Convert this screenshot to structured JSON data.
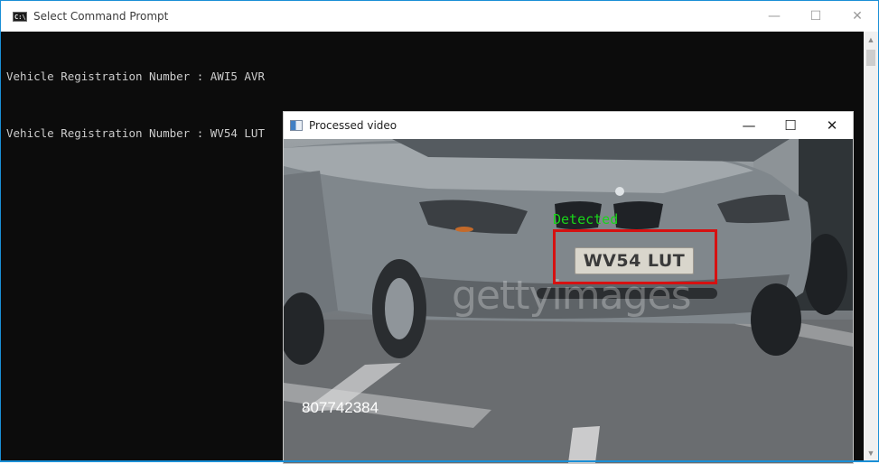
{
  "cmd": {
    "title": "Select Command Prompt",
    "icon": "console-icon",
    "lines": [
      "Vehicle Registration Number : AWI5 AVR",
      "Vehicle Registration Number : WV54 LUT"
    ],
    "controls": {
      "minimize": "—",
      "maximize": "☐",
      "close": "✕"
    },
    "scrollbar": {
      "up": "▲",
      "down": "▼"
    }
  },
  "video": {
    "title": "Processed video",
    "icon": "video-window-icon",
    "controls": {
      "minimize": "—",
      "maximize": "☐",
      "close": "✕"
    },
    "plate_text": "WV54 LUT",
    "detection_label": "Detected",
    "watermark": "gettyimages",
    "frame_counter": "807742384",
    "colors": {
      "detection_box": "#d61111",
      "detection_label": "#19d419"
    }
  }
}
